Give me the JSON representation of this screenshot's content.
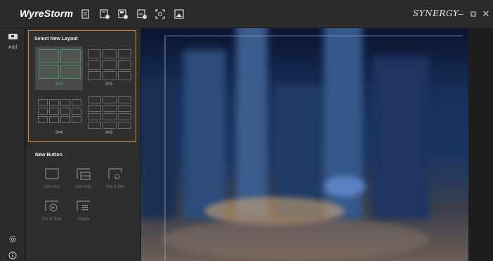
{
  "titlebar": {
    "logo": "WyreStorm",
    "brand": "SYNERGY",
    "toolbar_icons": [
      "copy-layout-icon",
      "add-page-icon",
      "add-source-icon",
      "add-display-icon",
      "capture-icon",
      "image-icon"
    ],
    "minimize": "–",
    "restore": "⧉",
    "close": "✕"
  },
  "rail": {
    "add_label": "Add",
    "settings_icon": "gear-icon",
    "info_icon": "info-icon"
  },
  "layout_panel": {
    "title": "Select New Layout",
    "options": [
      {
        "label": "2×2",
        "selected": true
      },
      {
        "label": "3×3",
        "selected": false
      },
      {
        "label": "3×4",
        "selected": false
      },
      {
        "label": "4×3",
        "selected": false
      }
    ]
  },
  "button_panel": {
    "title": "New Button",
    "buttons": [
      {
        "label": "Set only",
        "icon": "set-only-icon"
      },
      {
        "label": "Get only",
        "icon": "get-only-icon"
      },
      {
        "label": "Set & Get",
        "icon": "set-get-icon"
      },
      {
        "label": "Src & Sink",
        "icon": "source-sink-icon"
      },
      {
        "label": "Matrix",
        "icon": "matrix-icon"
      }
    ]
  },
  "colors": {
    "accent_orange": "#d9822b",
    "selected_green": "#5bb07c"
  }
}
